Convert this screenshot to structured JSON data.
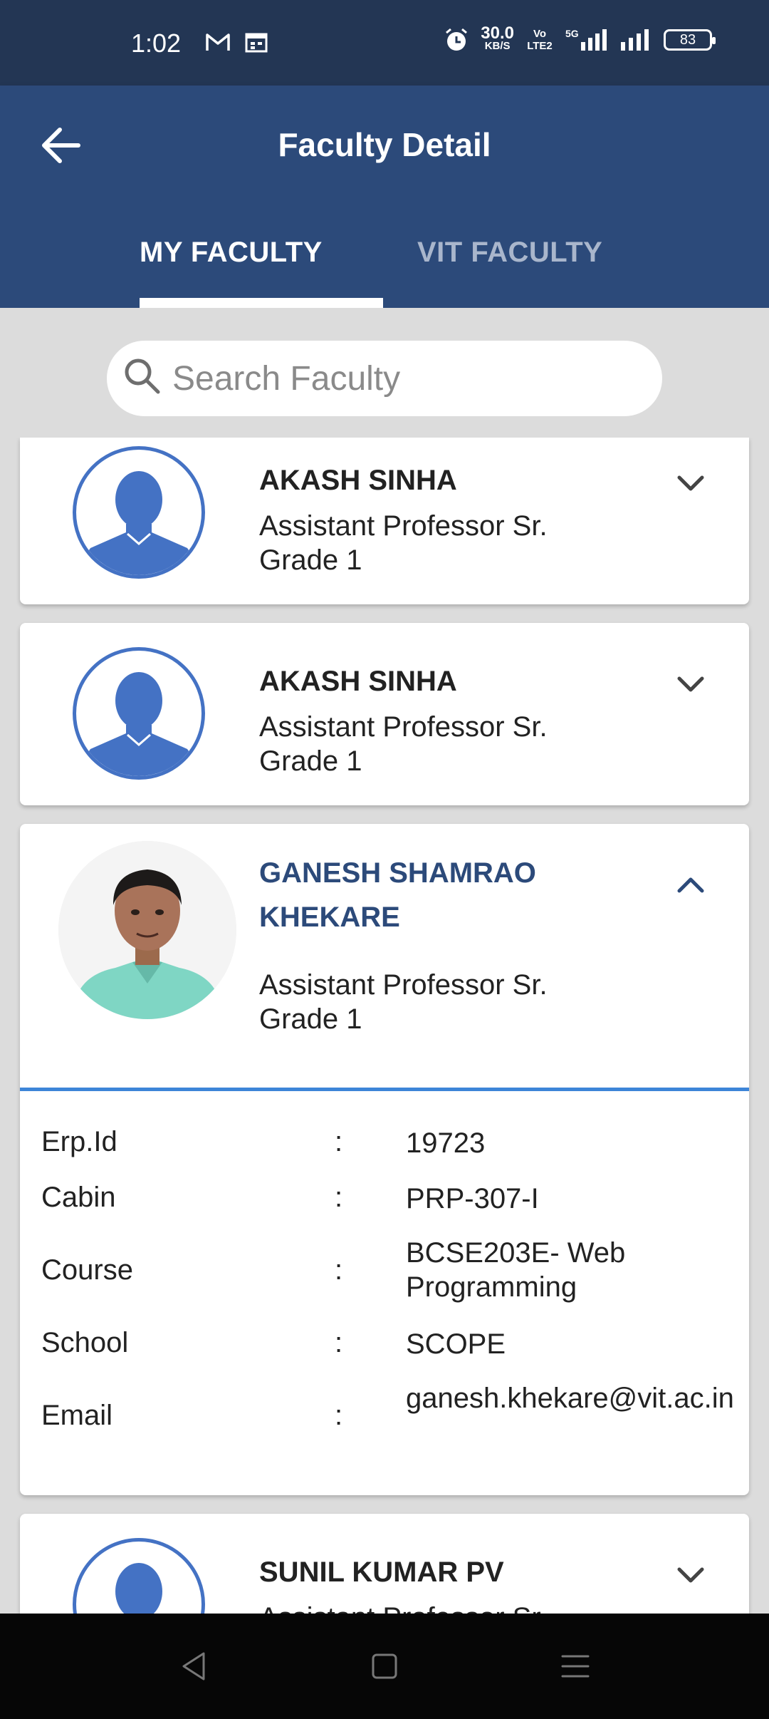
{
  "status_bar": {
    "time": "1:02",
    "left_icons": [
      "gmail-icon",
      "calendar-icon"
    ],
    "right_icons": [
      "alarm-icon",
      "vo-lte-icon",
      "5g-signal-icon",
      "signal-icon"
    ],
    "net_speed": "30.0",
    "net_unit": "KB/S",
    "volte": "Vo LTE2",
    "battery": "83"
  },
  "app_bar": {
    "title": "Faculty Detail"
  },
  "tabs": [
    {
      "label": "MY FACULTY",
      "selected": true
    },
    {
      "label": "VIT FACULTY",
      "selected": false
    }
  ],
  "search": {
    "placeholder": "Search Faculty",
    "value": ""
  },
  "faculty": [
    {
      "name": "AKASH SINHA",
      "designation": "Assistant Professor Sr. Grade 1",
      "expanded": false,
      "photo": "default-avatar"
    },
    {
      "name": "AKASH SINHA",
      "designation": "Assistant Professor Sr. Grade 1",
      "expanded": false,
      "photo": "default-avatar"
    },
    {
      "name": "GANESH SHAMRAO KHEKARE",
      "designation": "Assistant Professor Sr. Grade 1",
      "expanded": true,
      "photo": "faculty-photo",
      "details": [
        {
          "label": "Erp.Id",
          "value": "19723"
        },
        {
          "label": "Cabin",
          "value": "PRP-307-I"
        },
        {
          "label": "Course",
          "value": "BCSE203E- Web Programming"
        },
        {
          "label": "School",
          "value": "SCOPE"
        },
        {
          "label": "Email",
          "value": "ganesh.khekare@vit.ac.in"
        }
      ]
    },
    {
      "name": "SUNIL KUMAR PV",
      "designation": "Assistant Professor Sr.",
      "expanded": false,
      "photo": "default-avatar"
    }
  ],
  "detail_separator": ":",
  "colors": {
    "primary": "#2c4a7a",
    "status_bar": "#233654",
    "accent_line": "#3d85d8",
    "avatar": "#4472c4",
    "background": "#dcdcdc"
  }
}
